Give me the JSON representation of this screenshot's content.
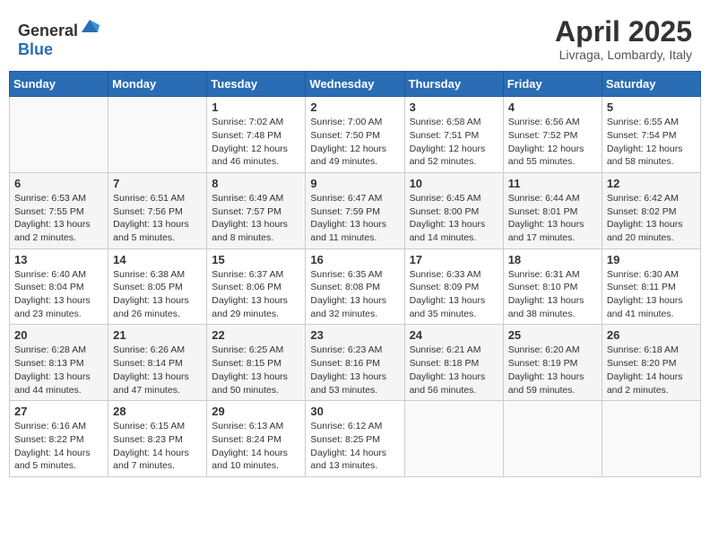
{
  "header": {
    "logo_general": "General",
    "logo_blue": "Blue",
    "month_year": "April 2025",
    "location": "Livraga, Lombardy, Italy"
  },
  "weekdays": [
    "Sunday",
    "Monday",
    "Tuesday",
    "Wednesday",
    "Thursday",
    "Friday",
    "Saturday"
  ],
  "weeks": [
    [
      {
        "day": "",
        "info": ""
      },
      {
        "day": "",
        "info": ""
      },
      {
        "day": "1",
        "info": "Sunrise: 7:02 AM\nSunset: 7:48 PM\nDaylight: 12 hours and 46 minutes."
      },
      {
        "day": "2",
        "info": "Sunrise: 7:00 AM\nSunset: 7:50 PM\nDaylight: 12 hours and 49 minutes."
      },
      {
        "day": "3",
        "info": "Sunrise: 6:58 AM\nSunset: 7:51 PM\nDaylight: 12 hours and 52 minutes."
      },
      {
        "day": "4",
        "info": "Sunrise: 6:56 AM\nSunset: 7:52 PM\nDaylight: 12 hours and 55 minutes."
      },
      {
        "day": "5",
        "info": "Sunrise: 6:55 AM\nSunset: 7:54 PM\nDaylight: 12 hours and 58 minutes."
      }
    ],
    [
      {
        "day": "6",
        "info": "Sunrise: 6:53 AM\nSunset: 7:55 PM\nDaylight: 13 hours and 2 minutes."
      },
      {
        "day": "7",
        "info": "Sunrise: 6:51 AM\nSunset: 7:56 PM\nDaylight: 13 hours and 5 minutes."
      },
      {
        "day": "8",
        "info": "Sunrise: 6:49 AM\nSunset: 7:57 PM\nDaylight: 13 hours and 8 minutes."
      },
      {
        "day": "9",
        "info": "Sunrise: 6:47 AM\nSunset: 7:59 PM\nDaylight: 13 hours and 11 minutes."
      },
      {
        "day": "10",
        "info": "Sunrise: 6:45 AM\nSunset: 8:00 PM\nDaylight: 13 hours and 14 minutes."
      },
      {
        "day": "11",
        "info": "Sunrise: 6:44 AM\nSunset: 8:01 PM\nDaylight: 13 hours and 17 minutes."
      },
      {
        "day": "12",
        "info": "Sunrise: 6:42 AM\nSunset: 8:02 PM\nDaylight: 13 hours and 20 minutes."
      }
    ],
    [
      {
        "day": "13",
        "info": "Sunrise: 6:40 AM\nSunset: 8:04 PM\nDaylight: 13 hours and 23 minutes."
      },
      {
        "day": "14",
        "info": "Sunrise: 6:38 AM\nSunset: 8:05 PM\nDaylight: 13 hours and 26 minutes."
      },
      {
        "day": "15",
        "info": "Sunrise: 6:37 AM\nSunset: 8:06 PM\nDaylight: 13 hours and 29 minutes."
      },
      {
        "day": "16",
        "info": "Sunrise: 6:35 AM\nSunset: 8:08 PM\nDaylight: 13 hours and 32 minutes."
      },
      {
        "day": "17",
        "info": "Sunrise: 6:33 AM\nSunset: 8:09 PM\nDaylight: 13 hours and 35 minutes."
      },
      {
        "day": "18",
        "info": "Sunrise: 6:31 AM\nSunset: 8:10 PM\nDaylight: 13 hours and 38 minutes."
      },
      {
        "day": "19",
        "info": "Sunrise: 6:30 AM\nSunset: 8:11 PM\nDaylight: 13 hours and 41 minutes."
      }
    ],
    [
      {
        "day": "20",
        "info": "Sunrise: 6:28 AM\nSunset: 8:13 PM\nDaylight: 13 hours and 44 minutes."
      },
      {
        "day": "21",
        "info": "Sunrise: 6:26 AM\nSunset: 8:14 PM\nDaylight: 13 hours and 47 minutes."
      },
      {
        "day": "22",
        "info": "Sunrise: 6:25 AM\nSunset: 8:15 PM\nDaylight: 13 hours and 50 minutes."
      },
      {
        "day": "23",
        "info": "Sunrise: 6:23 AM\nSunset: 8:16 PM\nDaylight: 13 hours and 53 minutes."
      },
      {
        "day": "24",
        "info": "Sunrise: 6:21 AM\nSunset: 8:18 PM\nDaylight: 13 hours and 56 minutes."
      },
      {
        "day": "25",
        "info": "Sunrise: 6:20 AM\nSunset: 8:19 PM\nDaylight: 13 hours and 59 minutes."
      },
      {
        "day": "26",
        "info": "Sunrise: 6:18 AM\nSunset: 8:20 PM\nDaylight: 14 hours and 2 minutes."
      }
    ],
    [
      {
        "day": "27",
        "info": "Sunrise: 6:16 AM\nSunset: 8:22 PM\nDaylight: 14 hours and 5 minutes."
      },
      {
        "day": "28",
        "info": "Sunrise: 6:15 AM\nSunset: 8:23 PM\nDaylight: 14 hours and 7 minutes."
      },
      {
        "day": "29",
        "info": "Sunrise: 6:13 AM\nSunset: 8:24 PM\nDaylight: 14 hours and 10 minutes."
      },
      {
        "day": "30",
        "info": "Sunrise: 6:12 AM\nSunset: 8:25 PM\nDaylight: 14 hours and 13 minutes."
      },
      {
        "day": "",
        "info": ""
      },
      {
        "day": "",
        "info": ""
      },
      {
        "day": "",
        "info": ""
      }
    ]
  ]
}
